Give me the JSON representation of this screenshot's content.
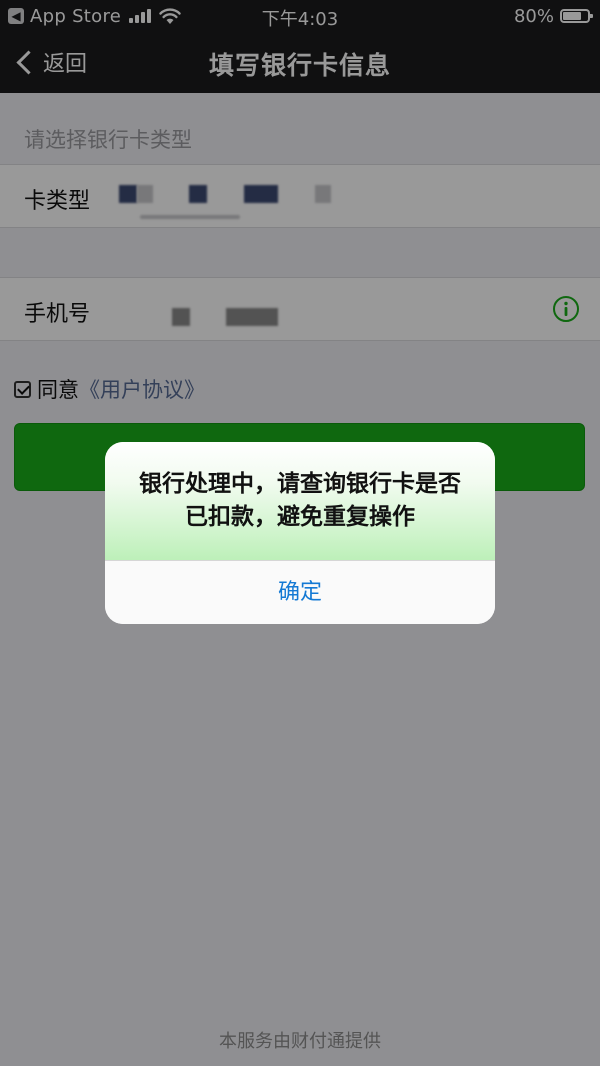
{
  "status_bar": {
    "back_app": "App Store",
    "time": "下午4:03",
    "battery": "80%",
    "battery_level": 0.8
  },
  "nav": {
    "back_label": "返回",
    "title": "填写银行卡信息"
  },
  "form": {
    "section_label": "请选择银行卡类型",
    "card_type_label": "卡类型",
    "phone_label": "手机号"
  },
  "agreement": {
    "prefix": "同意",
    "link": "《用户协议》",
    "checked": true
  },
  "footer": "本服务由财付通提供",
  "alert": {
    "message": "银行处理中，请查询银行卡是否已扣款，避免重复操作",
    "confirm_label": "确定"
  },
  "colors": {
    "nav_background": "#1b1b1d",
    "primary_green": "#1aad19",
    "link_blue": "#576b95",
    "alert_button_blue": "#1479d4",
    "info_icon_green": "#1aad19"
  }
}
